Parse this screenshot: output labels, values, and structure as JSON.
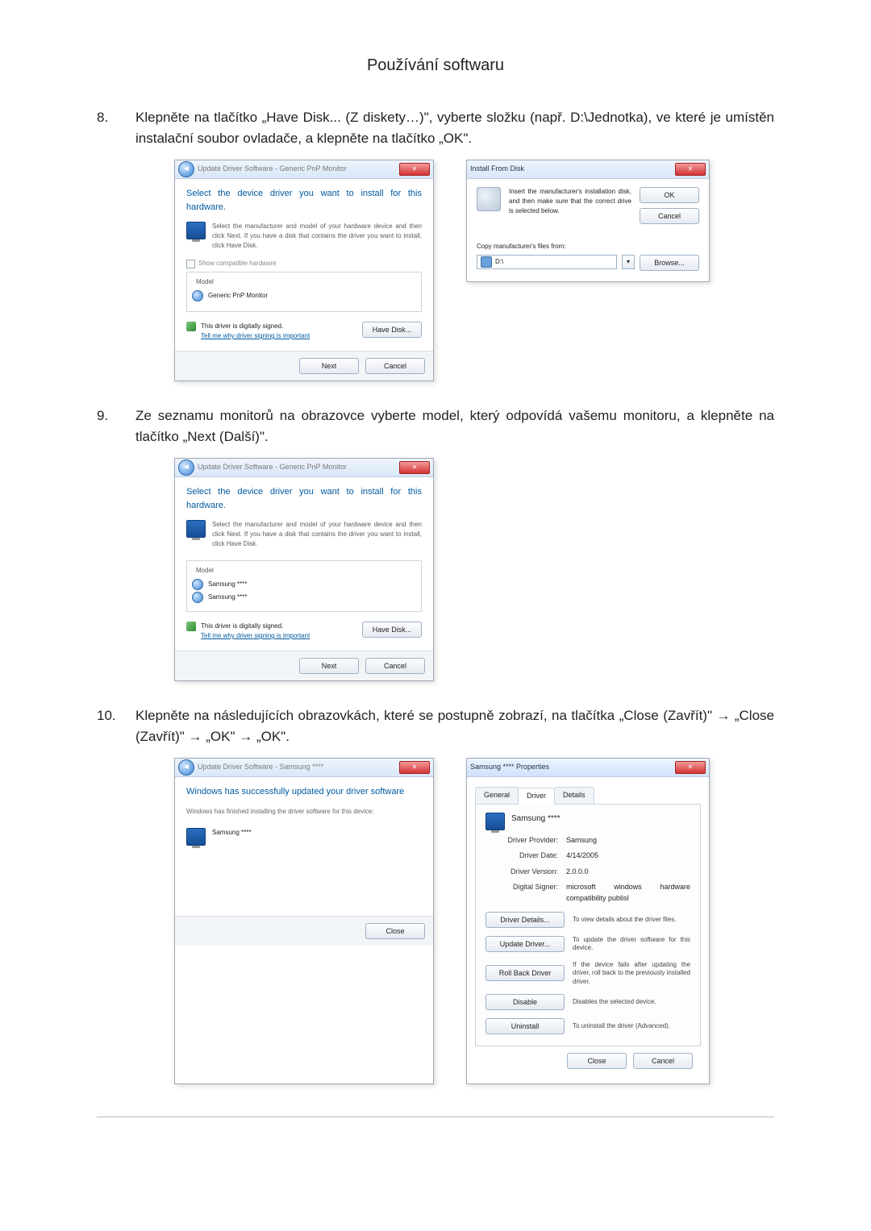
{
  "page": {
    "title": "Používání softwaru"
  },
  "steps": {
    "s8": "Klepněte na tlačítko „Have Disk... (Z diskety…)\", vyberte složku (např. D:\\Jednotka), ve které je umístěn instalační soubor ovladače, a klepněte na tlačítko „OK\".",
    "s9": "Ze seznamu monitorů na obrazovce vyberte model, který odpovídá vašemu monitoru, a klepněte na tlačítko „Next (Další)\".",
    "s10": "Klepněte na následujících obrazovkách, které se postupně zobrazí, na tlačítka „Close (Zavřít)\" → „Close (Zavřít)\" → „OK\" → „OK\"."
  },
  "dlg": {
    "update_driver_title": "Update Driver Software - Generic PnP Monitor",
    "select_driver_heading": "Select the device driver you want to install for this hardware.",
    "select_driver_hint": "Select the manufacturer and model of your hardware device and then click Next. If you have a disk that contains the driver you want to install, click Have Disk.",
    "show_compat": "Show compatible hardware",
    "model_label": "Model",
    "generic_pnp": "Generic PnP Monitor",
    "signed_text": "This driver is digitally signed.",
    "signed_link": "Tell me why driver signing is important",
    "have_disk_btn": "Have Disk...",
    "next_btn": "Next",
    "cancel_btn": "Cancel",
    "close_btn": "Close"
  },
  "ifd": {
    "title": "Install From Disk",
    "text": "Insert the manufacturer's installation disk, and then make sure that the correct drive is selected below.",
    "ok_btn": "OK",
    "cancel_btn": "Cancel",
    "copy_label": "Copy manufacturer's files from:",
    "path": "D:\\",
    "browse_btn": "Browse..."
  },
  "dlg2": {
    "samsung_model": "Samsung ****",
    "update_title_samsung": "Update Driver Software - Samsung ****",
    "success_heading": "Windows has successfully updated your driver software",
    "success_hint": "Windows has finished installing the driver software for this device:"
  },
  "props": {
    "title": "Samsung **** Properties",
    "tab_general": "General",
    "tab_driver": "Driver",
    "tab_details": "Details",
    "device_name": "Samsung ****",
    "provider_k": "Driver Provider:",
    "provider_v": "Samsung",
    "date_k": "Driver Date:",
    "date_v": "4/14/2005",
    "version_k": "Driver Version:",
    "version_v": "2.0.0.0",
    "signer_k": "Digital Signer:",
    "signer_v": "microsoft windows hardware compatibility publisl",
    "btn_details": "Driver Details...",
    "btn_details_d": "To view details about the driver files.",
    "btn_update": "Update Driver...",
    "btn_update_d": "To update the driver software for this device.",
    "btn_rollback": "Roll Back Driver",
    "btn_rollback_d": "If the device fails after updating the driver, roll back to the previously installed driver.",
    "btn_disable": "Disable",
    "btn_disable_d": "Disables the selected device.",
    "btn_uninstall": "Uninstall",
    "btn_uninstall_d": "To uninstall the driver (Advanced).",
    "close_btn": "Close",
    "cancel_btn": "Cancel"
  }
}
